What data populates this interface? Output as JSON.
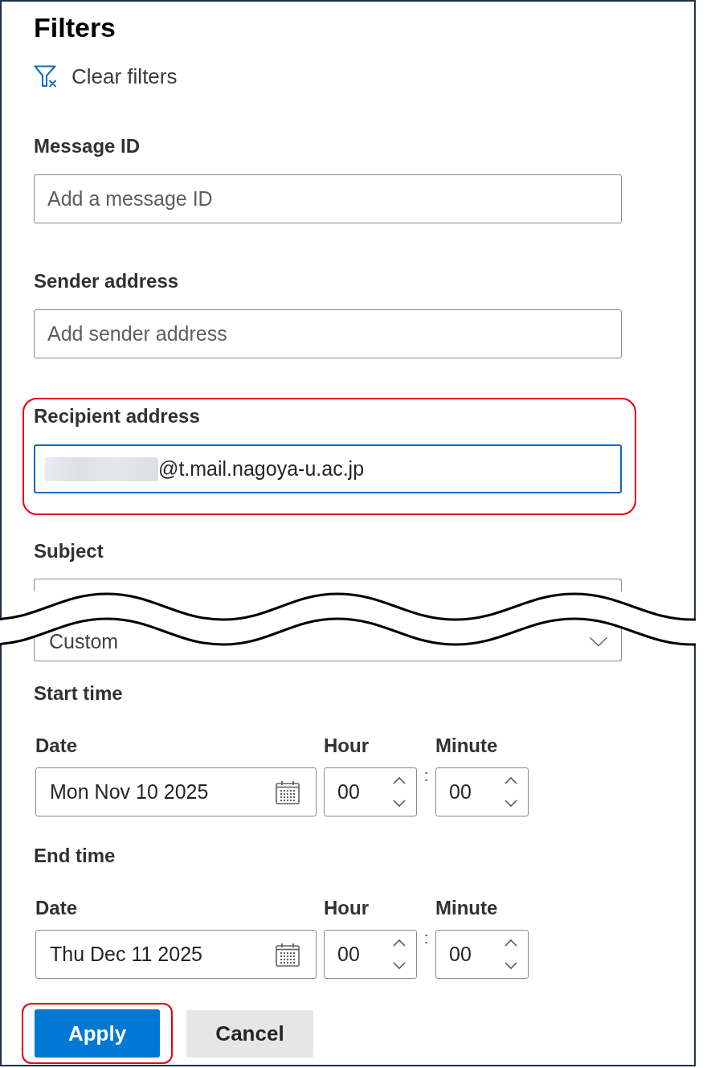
{
  "panel": {
    "title": "Filters"
  },
  "clear_filters": {
    "label": "Clear filters"
  },
  "text_fields": [
    {
      "label": "Message ID",
      "placeholder": "Add a message ID",
      "redacted_prefix": false,
      "focused": false,
      "highlighted": false
    },
    {
      "label": "Sender address",
      "placeholder": "Add sender address",
      "redacted_prefix": false,
      "focused": false,
      "highlighted": false
    },
    {
      "label": "Recipient address",
      "value": "@t.mail.nagoya-u.ac.jp",
      "redacted_prefix": true,
      "focused": true,
      "highlighted": true
    }
  ],
  "subject": {
    "label": "Subject"
  },
  "date_range": {
    "value": "Custom"
  },
  "time_ranges": [
    {
      "title": "Start time",
      "date_label": "Date",
      "date": "Mon Nov 10 2025",
      "hour_label": "Hour",
      "hour": "00",
      "separator": ":",
      "minute_label": "Minute",
      "minute": "00"
    },
    {
      "title": "End time",
      "date_label": "Date",
      "date": "Thu Dec 11 2025",
      "hour_label": "Hour",
      "hour": "00",
      "separator": ":",
      "minute_label": "Minute",
      "minute": "00"
    }
  ],
  "buttons": [
    {
      "label": "Apply",
      "kind": "primary",
      "highlighted": true
    },
    {
      "label": "Cancel",
      "kind": "secondary",
      "highlighted": false
    }
  ]
}
